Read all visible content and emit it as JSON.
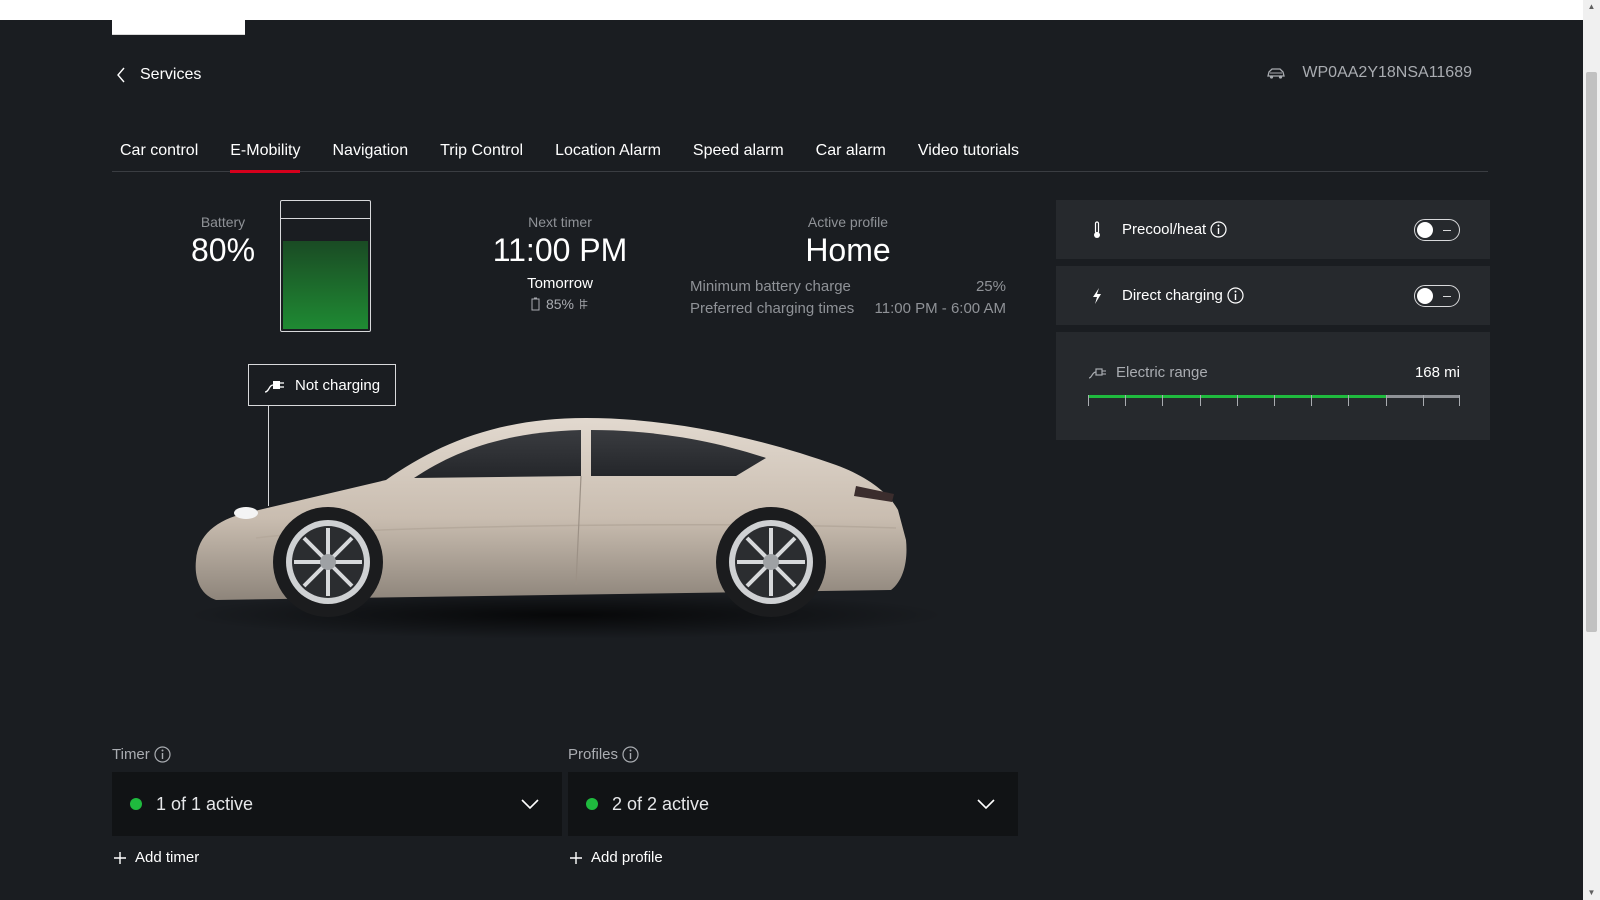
{
  "nav": {
    "back_label": "Services",
    "vin": "WP0AA2Y18NSA11689",
    "tabs": [
      {
        "label": "Car control"
      },
      {
        "label": "E-Mobility"
      },
      {
        "label": "Navigation"
      },
      {
        "label": "Trip Control"
      },
      {
        "label": "Location Alarm"
      },
      {
        "label": "Speed alarm"
      },
      {
        "label": "Car alarm"
      },
      {
        "label": "Video tutorials"
      }
    ],
    "active_tab": "E-Mobility"
  },
  "battery": {
    "label": "Battery",
    "value": "80%",
    "level_fraction": 0.8,
    "fill_color": "#1f8a33"
  },
  "next_timer": {
    "label": "Next timer",
    "time": "11:00 PM",
    "day": "Tomorrow",
    "target_charge": "85%"
  },
  "active_profile": {
    "label": "Active profile",
    "name": "Home",
    "min_charge_label": "Minimum battery charge",
    "min_charge_value": "25%",
    "pref_times_label": "Preferred charging times",
    "pref_times_value": "11:00 PM - 6:00 AM"
  },
  "charging_status": {
    "label": "Not charging"
  },
  "controls": {
    "precool": {
      "label": "Precool/heat",
      "enabled": false
    },
    "direct_charging": {
      "label": "Direct charging",
      "enabled": false
    }
  },
  "range": {
    "label": "Electric range",
    "value": "168 mi",
    "fill_fraction": 0.8
  },
  "timer_section": {
    "label": "Timer",
    "status": "1 of 1 active",
    "add_label": "Add timer"
  },
  "profiles_section": {
    "label": "Profiles",
    "status": "2 of 2 active",
    "add_label": "Add profile"
  },
  "colors": {
    "accent": "#d5001c",
    "active_green": "#1fba3e",
    "background": "#1a1d21",
    "panel": "#26292d"
  }
}
